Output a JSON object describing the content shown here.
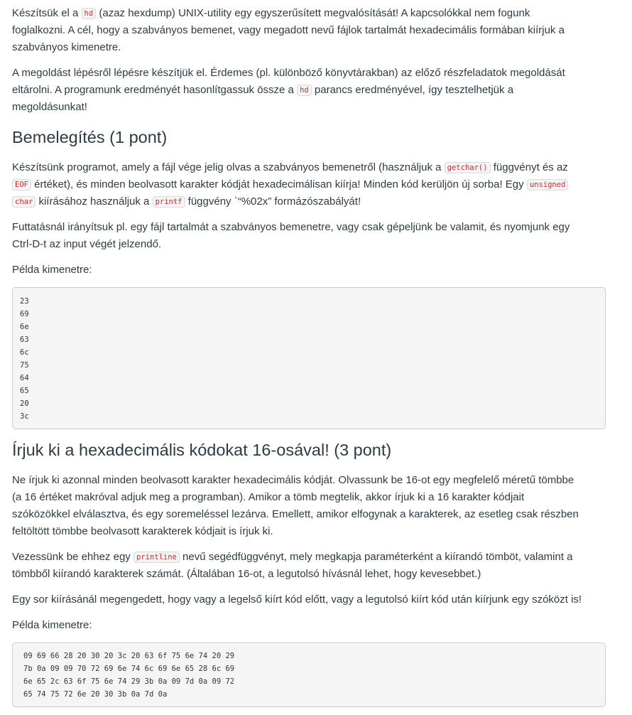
{
  "intro": {
    "p1": {
      "t1": "Készítsük el a ",
      "c1": "hd",
      "t2": " (azaz hexdump) UNIX-utility egy egyszerűsített megvalósítását! A kapcsolókkal nem fogunk",
      "l2": "foglalkozni. A cél, hogy a szabványos bemenet, vagy megadott nevű fájlok tartalmát hexadecimális formában kiírjuk a",
      "l3": "szabványos kimenetre."
    },
    "p2": {
      "l1": "A megoldást lépésről lépésre készítjük el. Érdemes (pl. különböző könyvtárakban) az előző részfeladatok megoldását",
      "l2a": "eltárolni. A programunk eredményét hasonlítgassuk össze a ",
      "c1": "hd",
      "l2b": " parancs eredményével, így tesztelhetjük a",
      "l3": "megoldásunkat!"
    }
  },
  "section1": {
    "title": "Bemelegítés (1 pont)",
    "p1": {
      "l1a": "Készítsünk programot, amely a fájl vége jelig olvas a szabványos bemenetről (használjuk a ",
      "c1": "getchar()",
      "l1b": " függvényt és az",
      "c2": "EOF",
      "l2a": " értéket), és minden beolvasott karakter kódját hexadecimálisan kiírja! Minden kód kerüljön új sorba! Egy ",
      "c3": "unsigned",
      "c4": "char",
      "l3a": " kiírásához használjuk a ",
      "c5": "printf",
      "l3b": " függvény `“%02x” formázószabályát!"
    },
    "p2": {
      "l1": "Futtatásnál irányítsuk pl. egy fájl tartalmát a szabványos bemenetre, vagy csak gépeljünk be valamit, és nyomjunk egy",
      "l2": "Ctrl-D-t az input végét jelzendő."
    },
    "example_label": "Példa kimenetre:",
    "example_output": "23\n69\n6e\n63\n6c\n75\n64\n65\n20\n3c"
  },
  "section2": {
    "title": "Írjuk ki a hexadecimális kódokat 16-osával! (3 pont)",
    "p1": {
      "l1": "Ne írjuk ki azonnal minden beolvasott karakter hexadecimális kódját. Olvassunk be 16-ot egy megfelelő méretű tömbbe",
      "l2": "(a 16 értéket makróval adjuk meg a programban). Amikor a tömb megtelik, akkor írjuk ki a 16 karakter kódjait",
      "l3": "szóközökkel elválasztva, és egy soremeléssel lezárva. Emellett, amikor elfogynak a karakterek, az esetleg csak részben",
      "l4": "feltöltött tömbbe beolvasott karakterek kódjait is írjuk ki."
    },
    "p2": {
      "l1a": "Vezessünk be ehhez egy ",
      "c1": "printline",
      "l1b": " nevű segédfüggvényt, mely megkapja paraméterként a kiírandó tömböt, valamint a",
      "l2": "tömbből kiírandó karakterek számát. (Általában 16-ot, a legutolsó hívásnál lehet, hogy kevesebbet.)"
    },
    "p3": "Egy sor kiírásánál megengedett, hogy vagy a legelső kiírt kód előtt, vagy a legutolsó kiírt kód után kiírjunk egy szóközt is!",
    "example_label": "Példa kimenetre:",
    "example_output": "09 69 66 28 20 30 20 3c 20 63 6f 75 6e 74 20 29\n7b 0a 09 09 70 72 69 6e 74 6c 69 6e 65 28 6c 69\n6e 65 2c 63 6f 75 6e 74 29 3b 0a 09 7d 0a 09 72\n65 74 75 72 6e 20 30 3b 0a 7d 0a"
  }
}
